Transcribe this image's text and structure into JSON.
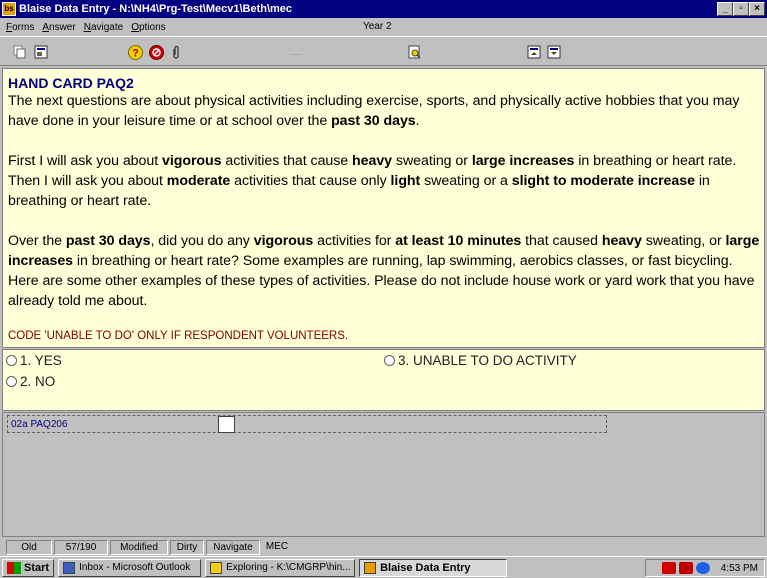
{
  "window": {
    "title": "Blaise Data Entry - N:\\NH4\\Prg-Test\\Mecv1\\Beth\\mec",
    "app_icon": "bs"
  },
  "menu": {
    "items": [
      "Forms",
      "Answer",
      "Navigate",
      "Options"
    ],
    "year": "Year 2"
  },
  "toolbar": {
    "separator": "....."
  },
  "question": {
    "hand_card": "HAND CARD PAQ2",
    "para1": [
      {
        "t": "The next questions are about physical activities including exercise, sports, and physically active hobbies that you may have done in your leisure time or at school over the ",
        "b": false
      },
      {
        "t": "past 30 days",
        "b": true
      },
      {
        "t": ".",
        "b": false
      }
    ],
    "para2": [
      {
        "t": "First I will ask you about ",
        "b": false
      },
      {
        "t": "vigorous",
        "b": true
      },
      {
        "t": " activities that cause ",
        "b": false
      },
      {
        "t": "heavy",
        "b": true
      },
      {
        "t": " sweating or ",
        "b": false
      },
      {
        "t": "large increases",
        "b": true
      },
      {
        "t": " in breathing or heart rate. Then I will ask you about ",
        "b": false
      },
      {
        "t": "moderate",
        "b": true
      },
      {
        "t": " activities that cause only ",
        "b": false
      },
      {
        "t": "light",
        "b": true
      },
      {
        "t": " sweating or a ",
        "b": false
      },
      {
        "t": "slight to moderate increase",
        "b": true
      },
      {
        "t": " in breathing or heart rate.",
        "b": false
      }
    ],
    "para3": [
      {
        "t": "Over the ",
        "b": false
      },
      {
        "t": "past 30 days",
        "b": true
      },
      {
        "t": ", did you do any ",
        "b": false
      },
      {
        "t": "vigorous",
        "b": true
      },
      {
        "t": " activities for ",
        "b": false
      },
      {
        "t": "at least 10 minutes",
        "b": true
      },
      {
        "t": " that caused ",
        "b": false
      },
      {
        "t": "heavy",
        "b": true
      },
      {
        "t": " sweating, or ",
        "b": false
      },
      {
        "t": "large increases",
        "b": true
      },
      {
        "t": " in breathing or heart rate? Some examples are running, lap swimming, aerobics classes, or fast bicycling. Here are some other examples of these types of activities. Please do not include house work or yard work that you have already told me about.",
        "b": false
      }
    ],
    "code_note": "CODE 'UNABLE TO DO' ONLY IF RESPONDENT VOLUNTEERS."
  },
  "answers": [
    {
      "label": "1. YES"
    },
    {
      "label": "2. NO"
    },
    {
      "label": "3.  UNABLE TO DO ACTIVITY"
    }
  ],
  "field": {
    "label": "02a PAQ206",
    "value": ""
  },
  "status": [
    "Old",
    "57/190",
    "Modified",
    "Dirty",
    "Navigate",
    "MEC"
  ],
  "taskbar": {
    "start": "Start",
    "tasks": [
      {
        "label": "Inbox - Microsoft Outlook",
        "icon": "outlook-icon",
        "active": false
      },
      {
        "label": "Exploring - K:\\CMGRP\\hin...",
        "icon": "explorer-icon",
        "active": false
      },
      {
        "label": "Blaise Data Entry",
        "icon": "blaise-icon",
        "active": true
      }
    ],
    "clock": "4:53 PM"
  }
}
